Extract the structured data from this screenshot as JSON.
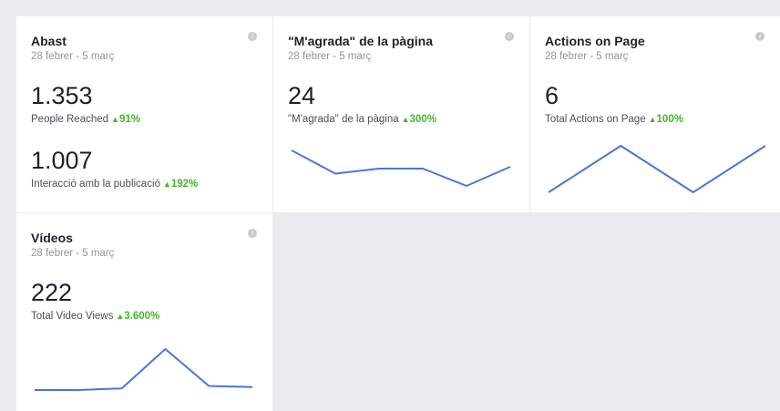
{
  "cards": [
    {
      "title": "Abast",
      "date": "28 febrer - 5 març",
      "metrics": [
        {
          "value": "1.353",
          "label": "People Reached",
          "change": "91%"
        },
        {
          "value": "1.007",
          "label": "Interacció amb la publicació",
          "change": "192%"
        }
      ]
    },
    {
      "title": "\"M'agrada\" de la pàgina",
      "date": "28 febrer - 5 març",
      "metrics": [
        {
          "value": "24",
          "label": "\"M'agrada\" de la pàgina",
          "change": "300%"
        }
      ],
      "trend": [
        0.78,
        0.27,
        0.38,
        0.38,
        0.0,
        0.42
      ]
    },
    {
      "title": "Actions on Page",
      "date": "28 febrer - 5 març",
      "metrics": [
        {
          "value": "6",
          "label": "Total Actions on Page",
          "change": "100%"
        }
      ],
      "trend": [
        0.0,
        1.0,
        0.0,
        1.0
      ]
    },
    {
      "title": "Vídeos",
      "date": "28 febrer - 5 març",
      "metrics": [
        {
          "value": "222",
          "label": "Total Video Views",
          "change": "3.600%"
        }
      ],
      "trend": [
        0.0,
        0.0,
        0.04,
        1.0,
        0.1,
        0.07
      ]
    }
  ],
  "colors": {
    "line": "#4a76d6",
    "positive": "#42b72a"
  },
  "icons": {
    "info": "info-icon",
    "up": "triangle-up-icon"
  }
}
